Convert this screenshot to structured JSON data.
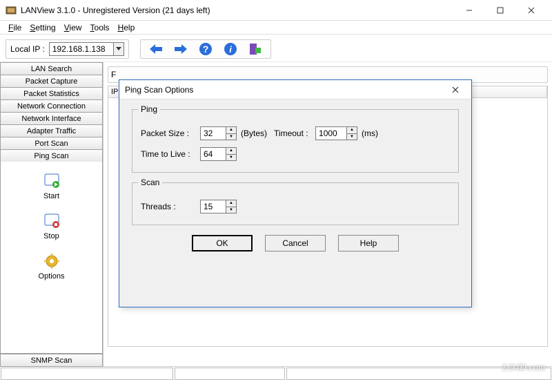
{
  "window": {
    "title": "LANView 3.1.0 - Unregistered Version (21 days left)"
  },
  "menu": {
    "file": "File",
    "setting": "Setting",
    "view": "View",
    "tools": "Tools",
    "help": "Help"
  },
  "toolbar": {
    "local_ip_label": "Local IP :",
    "local_ip_value": "192.168.1.138"
  },
  "sidebar": {
    "tabs": {
      "lan_search": "LAN Search",
      "packet_capture": "Packet Capture",
      "packet_stats": "Packet Statistics",
      "net_conn": "Network Connection",
      "net_iface": "Network Interface",
      "adapter_traffic": "Adapter Traffic",
      "port_scan": "Port Scan",
      "ping_scan": "Ping Scan",
      "snmp_scan": "SNMP Scan"
    },
    "actions": {
      "start": "Start",
      "stop": "Stop",
      "options": "Options"
    }
  },
  "grid": {
    "col_f": "F",
    "col_ip": "IP"
  },
  "dialog": {
    "title": "Ping Scan Options",
    "group_ping": "Ping",
    "group_scan": "Scan",
    "packet_size_label": "Packet Size   :",
    "packet_size_value": "32",
    "packet_size_unit": "(Bytes)",
    "timeout_label": "Timeout :",
    "timeout_value": "1000",
    "timeout_unit": "(ms)",
    "ttl_label": "Time to Live   :",
    "ttl_value": "64",
    "threads_label": "Threads       :",
    "threads_value": "15",
    "btn_ok": "OK",
    "btn_cancel": "Cancel",
    "btn_help": "Help"
  },
  "watermark": "LO4D.com"
}
